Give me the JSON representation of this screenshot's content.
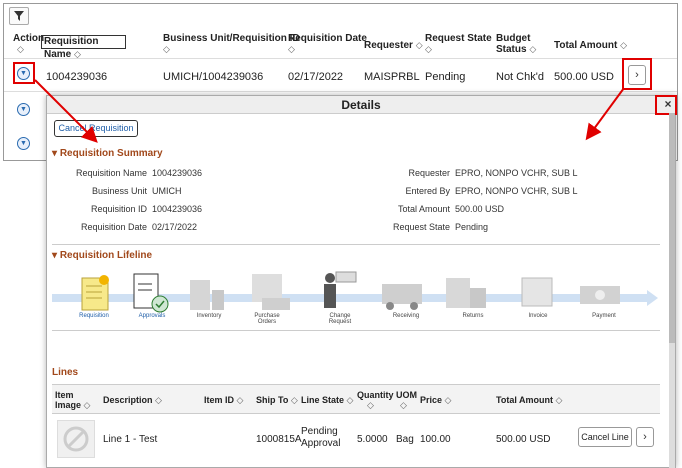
{
  "grid": {
    "headers": {
      "action": "Action",
      "req_name": "Requisition Name",
      "bu": "Business Unit/Requisition ID",
      "date": "Requisition Date",
      "requester": "Requester",
      "state": "Request State",
      "budget1": "Budget",
      "budget2": "Status",
      "total": "Total Amount"
    },
    "row": {
      "req_name": "1004239036",
      "bu": "UMICH/1004239036",
      "date": "02/17/2022",
      "requester": "MAISPRBL",
      "state": "Pending",
      "budget": "Not Chk'd",
      "total": "500.00 USD"
    },
    "sort_glyph": "◇"
  },
  "modal": {
    "title": "Details",
    "close": "×",
    "cancel_req": "Cancel Requisition",
    "summary_title": "Requisition Summary",
    "summary_left": [
      {
        "label": "Requisition Name",
        "value": "1004239036"
      },
      {
        "label": "Business Unit",
        "value": "UMICH"
      },
      {
        "label": "Requisition ID",
        "value": "1004239036"
      },
      {
        "label": "Requisition Date",
        "value": "02/17/2022"
      }
    ],
    "summary_right": [
      {
        "label": "Requester",
        "value": "EPRO, NONPO VCHR, SUB L"
      },
      {
        "label": "Entered By",
        "value": "EPRO, NONPO VCHR, SUB L"
      },
      {
        "label": "Total Amount",
        "value": "500.00 USD"
      },
      {
        "label": "Request State",
        "value": "Pending"
      }
    ],
    "lifeline_title": "Requisition Lifeline",
    "stages": [
      "Requisition",
      "Approvals",
      "Inventory",
      "Purchase Orders",
      "Change Request",
      "Receiving",
      "Returns",
      "Invoice",
      "Payment"
    ],
    "lines_title": "Lines",
    "lines_headers": {
      "img1": "Item",
      "img2": "Image",
      "desc": "Description",
      "item": "Item ID",
      "ship": "Ship To",
      "state": "Line State",
      "qty1": "Quantity",
      "uom": "UOM",
      "price": "Price",
      "total": "Total Amount"
    },
    "line": {
      "desc": "Line 1 - Test",
      "ship": "1000815A",
      "state1": "Pending",
      "state2": "Approval",
      "qty": "5.0000",
      "uom": "Bag",
      "price": "100.00",
      "total": "500.00 USD",
      "cancel": "Cancel Line"
    }
  },
  "colors": {
    "accent_red": "#e00000",
    "section_brown": "#a1481b",
    "link_blue": "#1f5ea8"
  }
}
